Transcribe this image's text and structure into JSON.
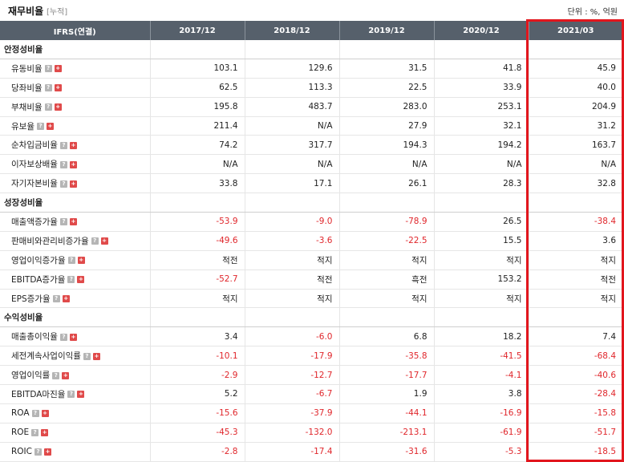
{
  "header": {
    "title": "재무비율",
    "subtitle": "[누적]",
    "unit": "단위 : %, 억원"
  },
  "columns": [
    "IFRS(연결)",
    "2017/12",
    "2018/12",
    "2019/12",
    "2020/12",
    "2021/03"
  ],
  "sections": [
    {
      "name": "안정성비율",
      "rows": [
        {
          "label": "유동비율",
          "values": [
            "103.1",
            "129.6",
            "31.5",
            "41.8",
            "45.9"
          ]
        },
        {
          "label": "당좌비율",
          "values": [
            "62.5",
            "113.3",
            "22.5",
            "33.9",
            "40.0"
          ]
        },
        {
          "label": "부채비율",
          "values": [
            "195.8",
            "483.7",
            "283.0",
            "253.1",
            "204.9"
          ]
        },
        {
          "label": "유보율",
          "values": [
            "211.4",
            "N/A",
            "27.9",
            "32.1",
            "31.2"
          ]
        },
        {
          "label": "순차입금비율",
          "values": [
            "74.2",
            "317.7",
            "194.3",
            "194.2",
            "163.7"
          ]
        },
        {
          "label": "이자보상배율",
          "values": [
            "N/A",
            "N/A",
            "N/A",
            "N/A",
            "N/A"
          ]
        },
        {
          "label": "자기자본비율",
          "values": [
            "33.8",
            "17.1",
            "26.1",
            "28.3",
            "32.8"
          ]
        }
      ]
    },
    {
      "name": "성장성비율",
      "rows": [
        {
          "label": "매출액증가율",
          "values": [
            "-53.9",
            "-9.0",
            "-78.9",
            "26.5",
            "-38.4"
          ]
        },
        {
          "label": "판매비와관리비증가율",
          "values": [
            "-49.6",
            "-3.6",
            "-22.5",
            "15.5",
            "3.6"
          ]
        },
        {
          "label": "영업이익증가율",
          "values": [
            "적전",
            "적지",
            "적지",
            "적지",
            "적지"
          ]
        },
        {
          "label": "EBITDA증가율",
          "values": [
            "-52.7",
            "적전",
            "흑전",
            "153.2",
            "적전"
          ]
        },
        {
          "label": "EPS증가율",
          "values": [
            "적지",
            "적지",
            "적지",
            "적지",
            "적지"
          ]
        }
      ]
    },
    {
      "name": "수익성비율",
      "rows": [
        {
          "label": "매출총이익율",
          "values": [
            "3.4",
            "-6.0",
            "6.8",
            "18.2",
            "7.4"
          ]
        },
        {
          "label": "세전계속사업이익률",
          "values": [
            "-10.1",
            "-17.9",
            "-35.8",
            "-41.5",
            "-68.4"
          ]
        },
        {
          "label": "영업이익률",
          "values": [
            "-2.9",
            "-12.7",
            "-17.7",
            "-4.1",
            "-40.6"
          ]
        },
        {
          "label": "EBITDA마진율",
          "values": [
            "5.2",
            "-6.7",
            "1.9",
            "3.8",
            "-28.4"
          ]
        },
        {
          "label": "ROA",
          "values": [
            "-15.6",
            "-37.9",
            "-44.1",
            "-16.9",
            "-15.8"
          ]
        },
        {
          "label": "ROE",
          "values": [
            "-45.3",
            "-132.0",
            "-213.1",
            "-61.9",
            "-51.7"
          ]
        },
        {
          "label": "ROIC",
          "values": [
            "-2.8",
            "-17.4",
            "-31.6",
            "-5.3",
            "-18.5"
          ]
        }
      ]
    }
  ],
  "icons": {
    "help": "?",
    "expand": "+"
  },
  "colors": {
    "negative": "#e0262b",
    "header_bg": "#56606b",
    "highlight": "#e2161d"
  }
}
